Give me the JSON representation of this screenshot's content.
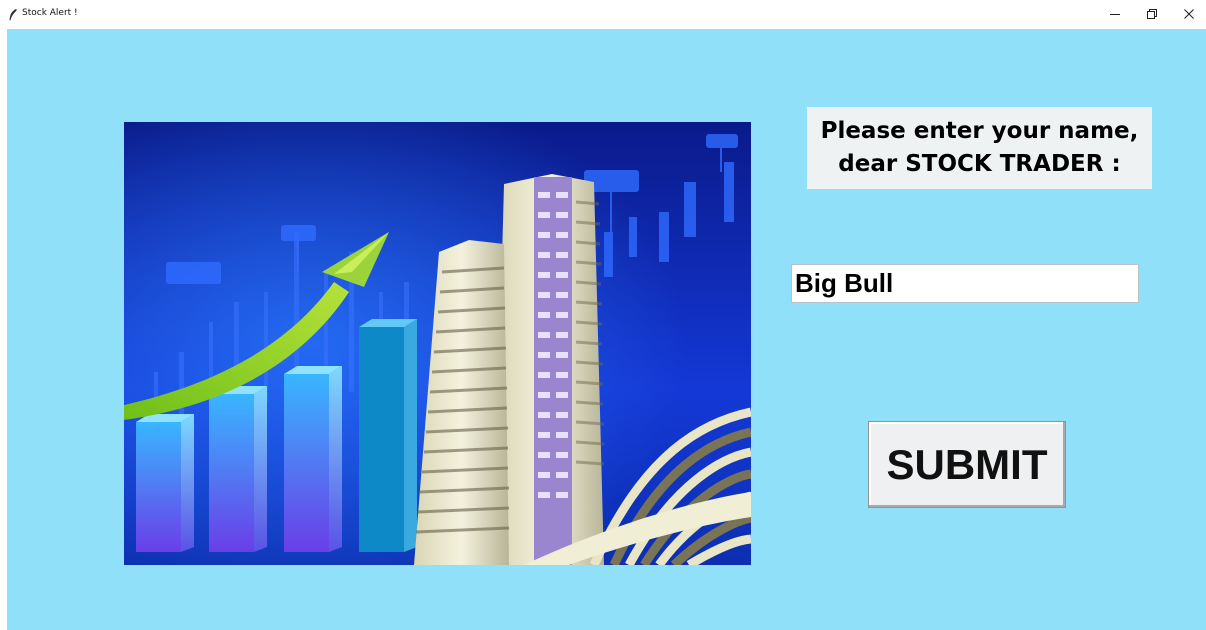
{
  "window": {
    "title": "Stock Alert !",
    "icon": "feather-icon",
    "controls": [
      "minimize-icon",
      "restore-icon",
      "close-icon"
    ]
  },
  "hero_image": {
    "alt": "stock market building with rising bar chart and green arrow"
  },
  "prompt": {
    "text": "Please enter your name,\ndear STOCK TRADER :"
  },
  "name_input": {
    "value": "Big Bull"
  },
  "submit": {
    "label": "SUBMIT"
  },
  "colors": {
    "background": "#90e0fa",
    "prompt_bg": "#eef2f3",
    "button_bg": "#eff0f1"
  }
}
